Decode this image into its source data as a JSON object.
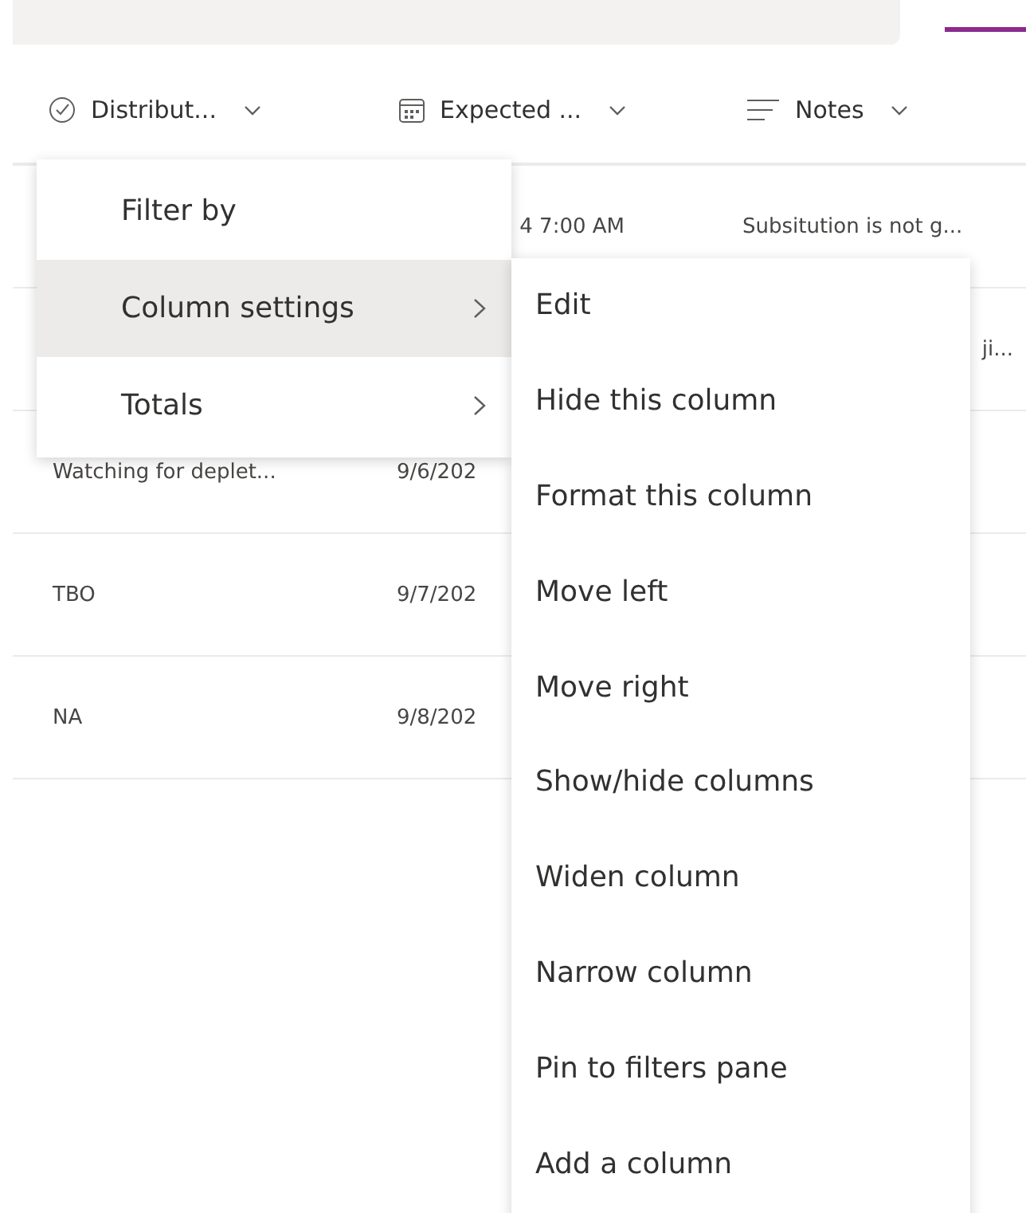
{
  "columns": [
    {
      "label": "Distribut..."
    },
    {
      "label": "Expected ..."
    },
    {
      "label": "Notes"
    }
  ],
  "rows": [
    [
      {
        "text": ""
      },
      {
        "text": "4 7:00 AM",
        "kind": "tail"
      },
      {
        "text": "Subsitution is not g..."
      }
    ],
    [
      {
        "text": ""
      },
      {
        "text": ""
      },
      {
        "text": "ji...",
        "kind": "tail"
      }
    ],
    [
      {
        "text": "Watching for deplet..."
      },
      {
        "text": "9/6/202"
      },
      {
        "text": ""
      }
    ],
    [
      {
        "text": "TBO"
      },
      {
        "text": "9/7/202"
      },
      {
        "text": ""
      }
    ],
    [
      {
        "text": "NA"
      },
      {
        "text": "9/8/202"
      },
      {
        "text": ""
      }
    ]
  ],
  "menu": {
    "items": [
      {
        "label": "Filter by",
        "submenu": false,
        "selected": false
      },
      {
        "label": "Column settings",
        "submenu": true,
        "selected": true
      },
      {
        "label": "Totals",
        "submenu": true,
        "selected": false
      }
    ],
    "submenu": [
      "Edit",
      "Hide this column",
      "Format this column",
      "Move left",
      "Move right",
      "Show/hide columns",
      "Widen column",
      "Narrow column",
      "Pin to filters pane",
      "Add a column"
    ]
  }
}
